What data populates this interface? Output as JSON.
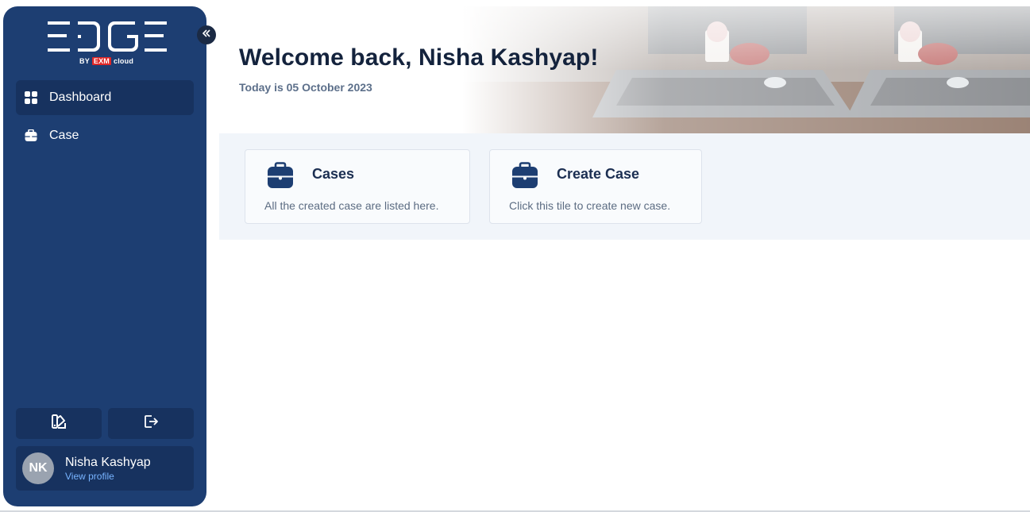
{
  "sidebar": {
    "logo": {
      "text": "EDGE",
      "by": "BY",
      "brand": "EXM",
      "cloud": "cloud"
    },
    "collapse_icon": "double-chevron-left-icon",
    "nav": [
      {
        "label": "Dashboard",
        "icon": "grid-icon",
        "active": true
      },
      {
        "label": "Case",
        "icon": "briefcase-icon",
        "active": false
      }
    ],
    "bottom_buttons": [
      {
        "icon": "theme-swatch-icon"
      },
      {
        "icon": "logout-icon"
      }
    ],
    "profile": {
      "initials": "NK",
      "name": "Nisha Kashyap",
      "link": "View profile"
    }
  },
  "hero": {
    "title": "Welcome back, Nisha Kashyap!",
    "date": "Today is 05 October 2023"
  },
  "tiles": [
    {
      "title": "Cases",
      "description": "All the created case are listed here.",
      "icon": "briefcase-icon"
    },
    {
      "title": "Create Case",
      "description": "Click this tile to create new case.",
      "icon": "briefcase-icon"
    }
  ],
  "colors": {
    "sidebar_bg": "#1d3e72",
    "active_bg": "#17325f",
    "title": "#14233d",
    "accent_link": "#78b4ff"
  }
}
